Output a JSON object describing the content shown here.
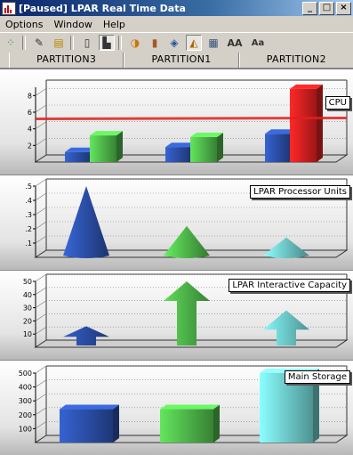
{
  "window": {
    "title": "[Paused] LPAR Real Time Data",
    "minimize": "_",
    "maximize": "□",
    "close": "×"
  },
  "menu": [
    "Options",
    "Window",
    "Help"
  ],
  "toolbar": {
    "icons": [
      "layout-icon",
      "pen-icon",
      "list-icon",
      "document-icon",
      "bar-icon",
      "pie-icon",
      "chart-bar-icon",
      "tilt-icon",
      "3d-icon",
      "stack-icon"
    ],
    "font_increase": "AA",
    "font_decrease": "Aa"
  },
  "columns": [
    "PARTITION3",
    "PARTITION1",
    "PARTITION2"
  ],
  "colors": {
    "blue": "#2b4fa8",
    "green": "#4fb84a",
    "red": "#e02020",
    "cyan": "#6fd0d0"
  },
  "chart_data": [
    {
      "type": "bar",
      "title": "CPU",
      "ylim": [
        0,
        9
      ],
      "yticks": [
        2,
        4,
        6,
        8
      ],
      "categories": [
        "PARTITION3",
        "PARTITION1",
        "PARTITION2"
      ],
      "series": [
        {
          "values": [
            1.2,
            1.8,
            3.4
          ]
        },
        {
          "values": [
            3.2,
            3.0,
            8.8
          ]
        }
      ],
      "reference_line": 5.2
    },
    {
      "type": "bar",
      "title": "LPAR Processor Units",
      "ylim": [
        0,
        0.5
      ],
      "yticks": [
        ".1",
        ".2",
        ".3",
        ".4",
        ".5"
      ],
      "categories": [
        "PARTITION3",
        "PARTITION1",
        "PARTITION2"
      ],
      "values": [
        0.5,
        0.22,
        0.14
      ],
      "shape": "cone"
    },
    {
      "type": "bar",
      "title": "LPAR Interactive Capacity",
      "ylim": [
        0,
        50
      ],
      "yticks": [
        10,
        20,
        30,
        40,
        50
      ],
      "categories": [
        "PARTITION3",
        "PARTITION1",
        "PARTITION2"
      ],
      "values": [
        16,
        50,
        28
      ],
      "shape": "arrow"
    },
    {
      "type": "bar",
      "title": "Main Storage",
      "ylim": [
        0,
        500
      ],
      "yticks": [
        100,
        200,
        300,
        400,
        500
      ],
      "categories": [
        "PARTITION3",
        "PARTITION1",
        "PARTITION2"
      ],
      "values": [
        240,
        240,
        500
      ],
      "shape": "box"
    }
  ]
}
